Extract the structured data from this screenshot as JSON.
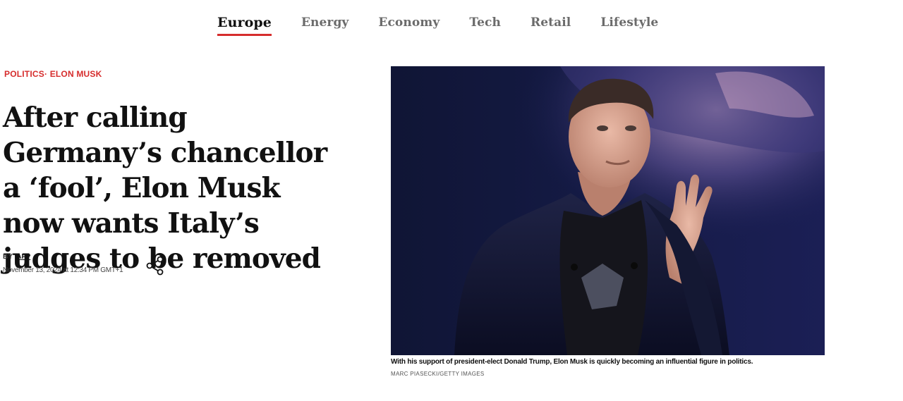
{
  "nav": {
    "items": [
      {
        "label": "Europe",
        "active": true
      },
      {
        "label": "Energy",
        "active": false
      },
      {
        "label": "Economy",
        "active": false
      },
      {
        "label": "Tech",
        "active": false
      },
      {
        "label": "Retail",
        "active": false
      },
      {
        "label": "Lifestyle",
        "active": false
      }
    ]
  },
  "article": {
    "category": "POLITICS",
    "separator": "·",
    "subcategory": "ELON MUSK",
    "headline": "After calling Germany’s chancellor a ‘fool’, Elon Musk now wants Italy’s judges to be removed",
    "byline_prefix": "BY",
    "author": "AFP",
    "date": "November 13, 2024 at 12:34 PM GMT+1",
    "share_icon": "share-icon"
  },
  "image": {
    "caption": "With his support of president-elect Donald Trump, Elon Musk is quickly becoming an influential figure in politics.",
    "credit": "MARC PIASECKI/GETTY IMAGES"
  },
  "colors": {
    "accent": "#d62d2d",
    "text": "#111111",
    "nav_inactive": "#6b6b6b"
  }
}
